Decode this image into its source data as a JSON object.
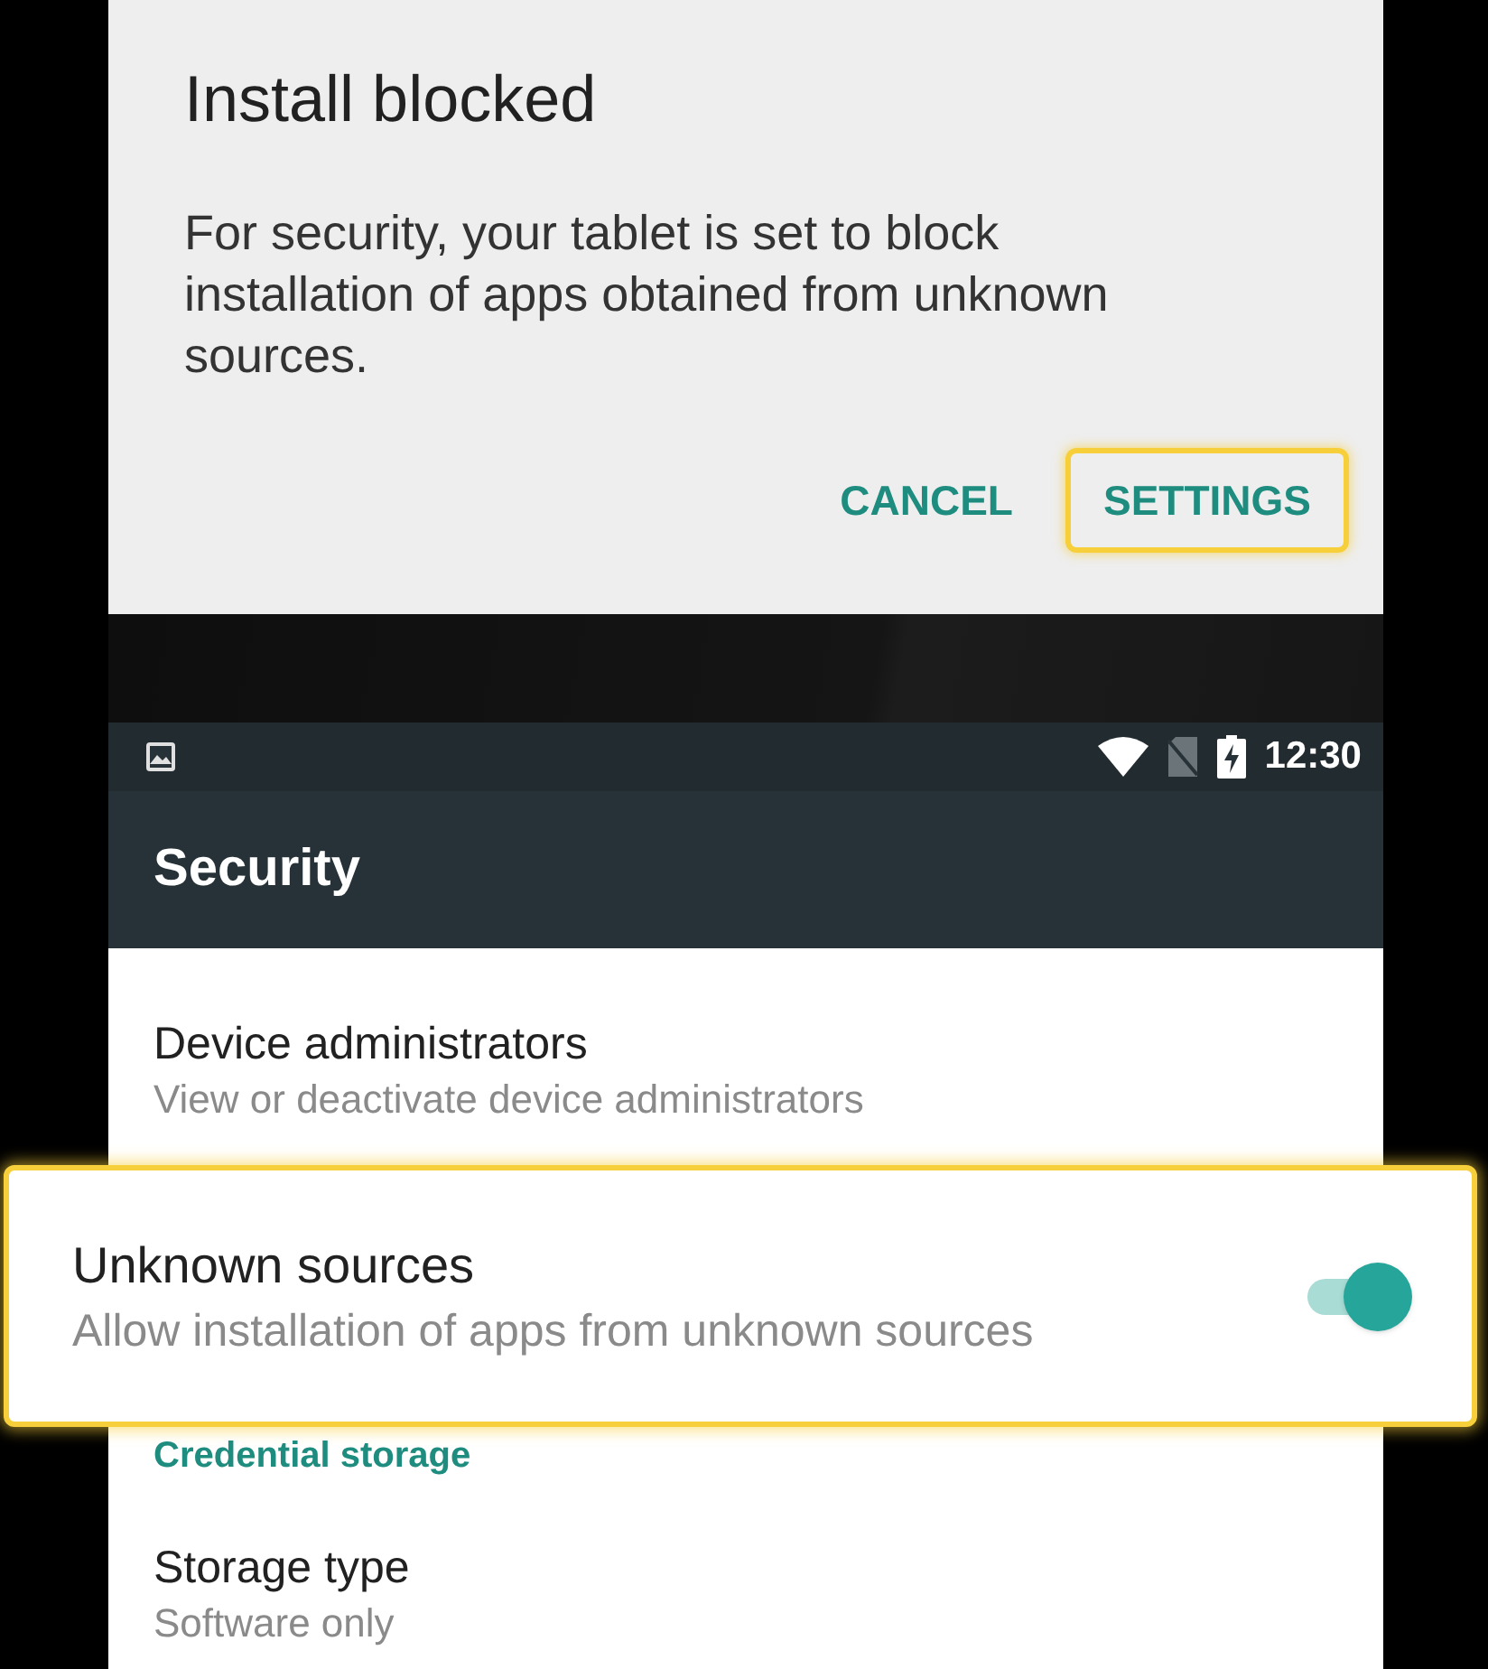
{
  "dialog": {
    "title": "Install blocked",
    "message": "For security, your tablet is set to block installation of apps obtained from unknown sources.",
    "buttons": [
      {
        "label": "CANCEL",
        "highlighted": false
      },
      {
        "label": "SETTINGS",
        "highlighted": true
      }
    ]
  },
  "status_bar": {
    "time": "12:30"
  },
  "toolbar": {
    "title": "Security"
  },
  "settings": [
    {
      "kind": "item",
      "title": "Device administrators",
      "summary": "View or deactivate device administrators",
      "highlighted": false
    },
    {
      "kind": "toggle",
      "title": "Unknown sources",
      "summary": "Allow installation of apps from unknown sources",
      "on": true,
      "highlighted": true
    },
    {
      "kind": "header",
      "title": "Credential storage"
    },
    {
      "kind": "item",
      "title": "Storage type",
      "summary": "Software only",
      "highlighted": false
    }
  ]
}
